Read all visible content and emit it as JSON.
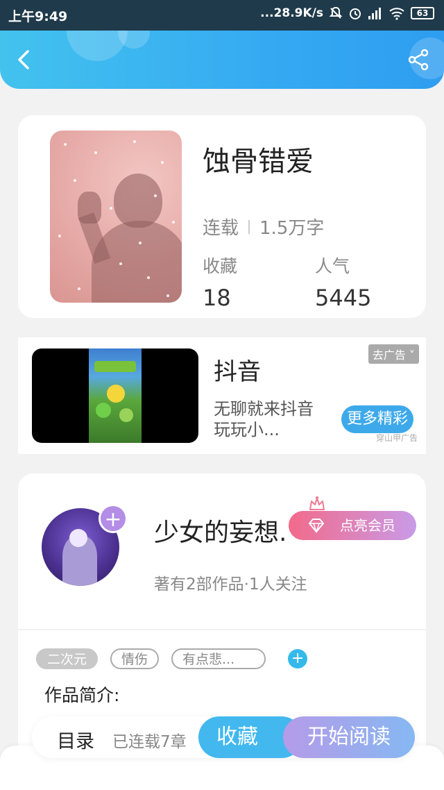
{
  "status_bar": {
    "time": "上午9:49",
    "network_speed": "...28.9K/s",
    "battery": "63"
  },
  "header": {
    "back_icon": "chevron-left-icon",
    "share_icon": "share-icon",
    "accent_color": "#35aaf2"
  },
  "book": {
    "title": "蚀骨错爱",
    "status": "连载",
    "word_count": "1.5万字",
    "favorites_label": "收藏",
    "favorites_value": "18",
    "popularity_label": "人气",
    "popularity_value": "5445"
  },
  "ad": {
    "title": "抖音",
    "description": "无聊就来抖音玩玩小...",
    "close_label": "去广告",
    "more_label": "更多精彩",
    "source": "穿山甲广告"
  },
  "author": {
    "name": "少女的妄想.",
    "meta": "著有2部作品·1人关注",
    "vip_label": "点亮会员",
    "follow_icon": "plus-icon"
  },
  "tags": {
    "items": [
      "二次元",
      "情伤",
      "有点悲..."
    ],
    "add_icon": "plus-icon"
  },
  "intro": {
    "label": "作品简介:"
  },
  "bottom_bar": {
    "toc_label": "目录",
    "toc_count": "已连载7章",
    "favorite_label": "收藏",
    "read_label": "开始阅读"
  }
}
